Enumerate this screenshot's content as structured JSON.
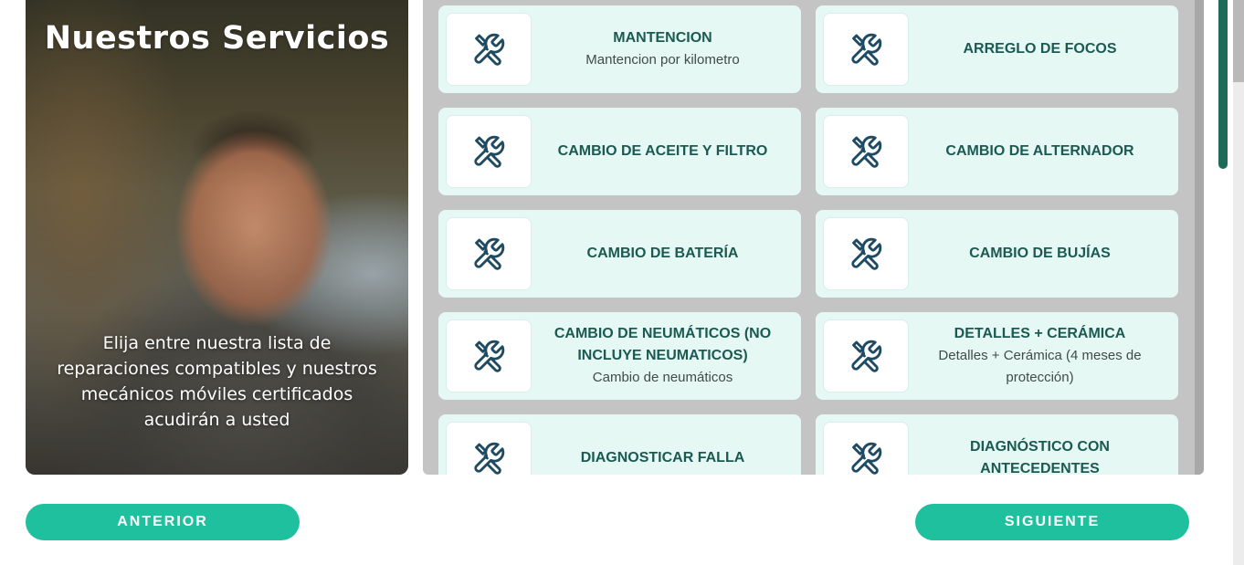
{
  "hero": {
    "title": "Nuestros Servicios",
    "description": "Elija entre nuestra lista de reparaciones compatibles y nuestros mecánicos móviles certificados acudirán a usted"
  },
  "services": [
    {
      "title": "MANTENCION",
      "subtitle": "Mantencion por kilometro",
      "icon": "wrench-screwdriver-icon"
    },
    {
      "title": "ARREGLO DE FOCOS",
      "subtitle": "",
      "icon": "wrench-screwdriver-icon"
    },
    {
      "title": "CAMBIO DE ACEITE Y FILTRO",
      "subtitle": "",
      "icon": "wrench-screwdriver-icon"
    },
    {
      "title": "CAMBIO DE ALTERNADOR",
      "subtitle": "",
      "icon": "wrench-screwdriver-icon"
    },
    {
      "title": "CAMBIO DE BATERÍA",
      "subtitle": "",
      "icon": "wrench-screwdriver-icon"
    },
    {
      "title": "CAMBIO DE BUJÍAS",
      "subtitle": "",
      "icon": "wrench-screwdriver-icon"
    },
    {
      "title": "CAMBIO DE NEUMÁTICOS (NO INCLUYE NEUMATICOS)",
      "subtitle": "Cambio de neumáticos",
      "icon": "wrench-screwdriver-icon"
    },
    {
      "title": "DETALLES + CERÁMICA",
      "subtitle": "Detalles + Cerámica (4 meses de protección)",
      "icon": "wrench-screwdriver-icon"
    },
    {
      "title": "DIAGNOSTICAR FALLA",
      "subtitle": "",
      "icon": "wrench-screwdriver-icon"
    },
    {
      "title": "DIAGNÓSTICO CON ANTECEDENTES",
      "subtitle": "",
      "icon": "wrench-screwdriver-icon"
    }
  ],
  "nav": {
    "prev_label": "ANTERIOR",
    "next_label": "SIGUIENTE"
  },
  "colors": {
    "accent": "#1fc09d",
    "card_bg": "#e6f8f3",
    "title_text": "#1b5a52",
    "icon": "#1e4a63"
  }
}
